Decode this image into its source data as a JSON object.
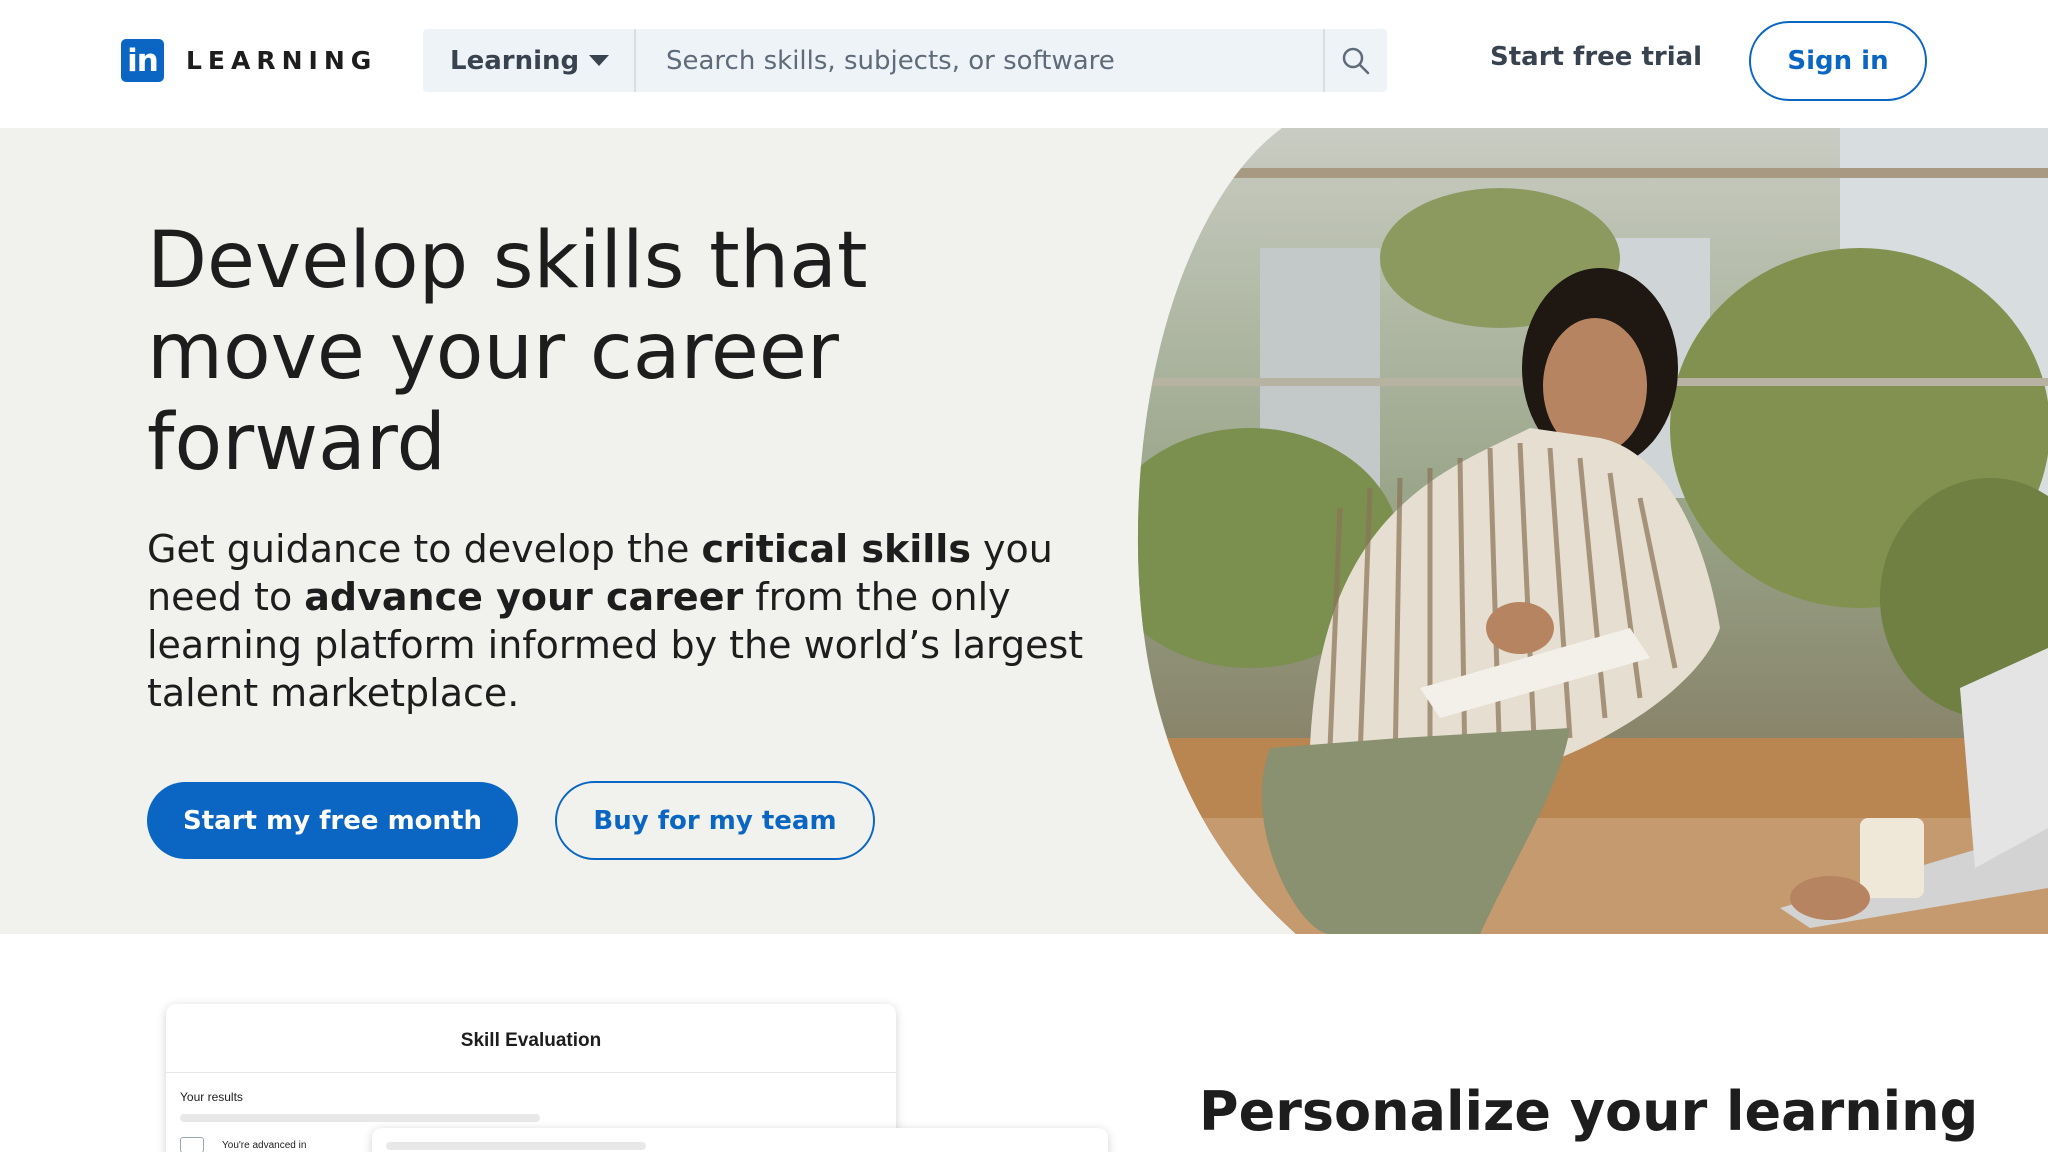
{
  "header": {
    "logo_mark": "in",
    "logo_word": "LEARNING",
    "search_category": "Learning",
    "search_placeholder": "Search skills, subjects, or software",
    "trial_link": "Start free trial",
    "signin": "Sign in"
  },
  "hero": {
    "title": "Develop skills that move your career forward",
    "desc_1": "Get guidance to develop the ",
    "desc_bold_1": "critical skills",
    "desc_2": " you need to ",
    "desc_bold_2": "advance your career",
    "desc_3": " from the only learning platform informed by the world’s largest talent marketplace.",
    "primary_cta": "Start my free month",
    "secondary_cta": "Buy for my team"
  },
  "skill_card": {
    "title": "Skill Evaluation",
    "results": "Your results",
    "advanced": "You're advanced in"
  },
  "section": {
    "personalize_title": "Personalize your learning"
  },
  "colors": {
    "brand": "#0a66c2",
    "hero_bg": "#f1f1ee"
  },
  "icons": {
    "logo": "linkedin-logo-icon",
    "caret": "caret-down-icon",
    "search": "search-icon"
  }
}
